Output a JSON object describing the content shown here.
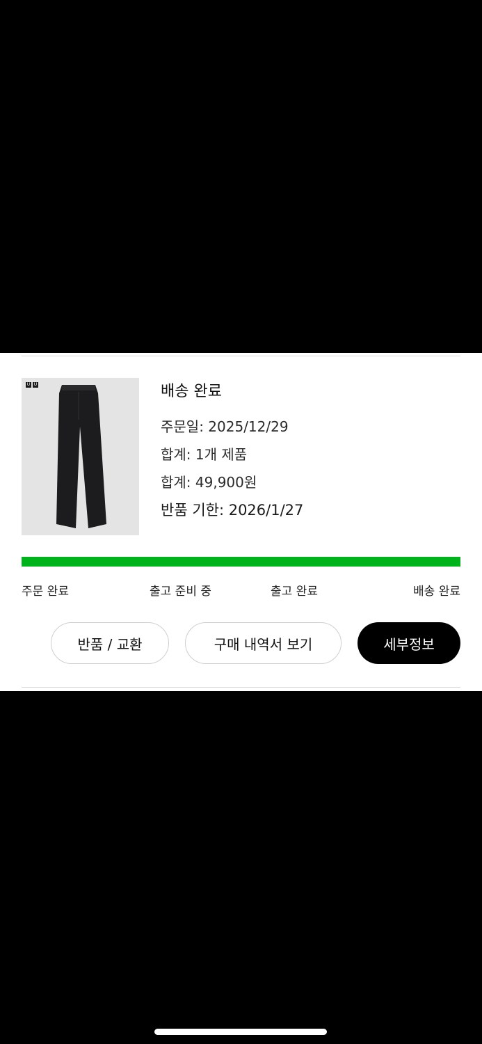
{
  "order": {
    "status": "배송 완료",
    "order_date": "주문일: 2025/12/29",
    "item_count": "합계: 1개 제품",
    "total_price": "합계: 49,900원",
    "return_deadline": "반품 기한: 2026/1/27",
    "thumbnail_icon": "pants-product-image",
    "brand_badge": [
      "U",
      "U"
    ]
  },
  "progress": {
    "fraction": 1.0,
    "color": "#00b31b",
    "steps": [
      "주문 완료",
      "출고 준비 중",
      "출고 완료",
      "배송 완료"
    ]
  },
  "actions": {
    "return_exchange": "반품 / 교환",
    "view_receipt": "구매 내역서 보기",
    "details": "세부정보"
  }
}
